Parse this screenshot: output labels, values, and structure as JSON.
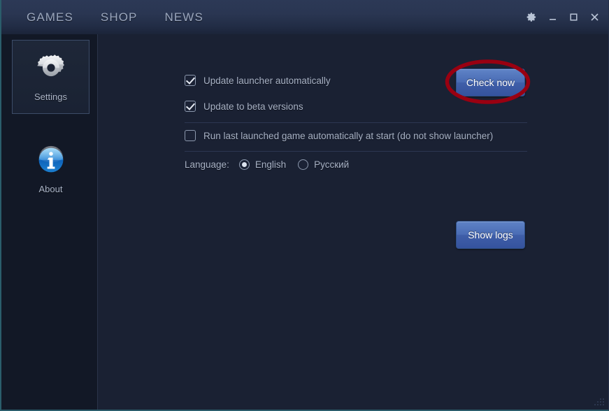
{
  "window": {
    "nav_tabs": [
      {
        "label": "GAMES",
        "name": "nav-tab-games"
      },
      {
        "label": "SHOP",
        "name": "nav-tab-shop"
      },
      {
        "label": "NEWS",
        "name": "nav-tab-news"
      }
    ],
    "controls": {
      "settings": "gear-icon",
      "minimize": "minimize-icon",
      "maximize": "maximize-icon",
      "close": "close-icon"
    },
    "accent_border": "#2b5d6b",
    "titlebar_bg": "#2a3652",
    "content_bg": "#1a2133",
    "sidebar_bg": "#121826"
  },
  "sidebar": {
    "items": [
      {
        "label": "Settings",
        "icon": "gear-icon",
        "selected": true
      },
      {
        "label": "About",
        "icon": "info-icon",
        "selected": false
      }
    ]
  },
  "settings": {
    "checkboxes": [
      {
        "label": "Update launcher automatically",
        "checked": true
      },
      {
        "label": "Update to beta versions",
        "checked": true
      },
      {
        "label": "Run last launched game automatically at start (do not show launcher)",
        "checked": false
      }
    ],
    "language": {
      "title": "Language:",
      "options": [
        {
          "label": "English",
          "selected": true
        },
        {
          "label": "Русский",
          "selected": false
        }
      ]
    },
    "buttons": {
      "check_now": "Check now",
      "show_logs": "Show logs"
    }
  },
  "annotation": {
    "shape": "ellipse",
    "color": "#990011",
    "target": "Check now"
  }
}
